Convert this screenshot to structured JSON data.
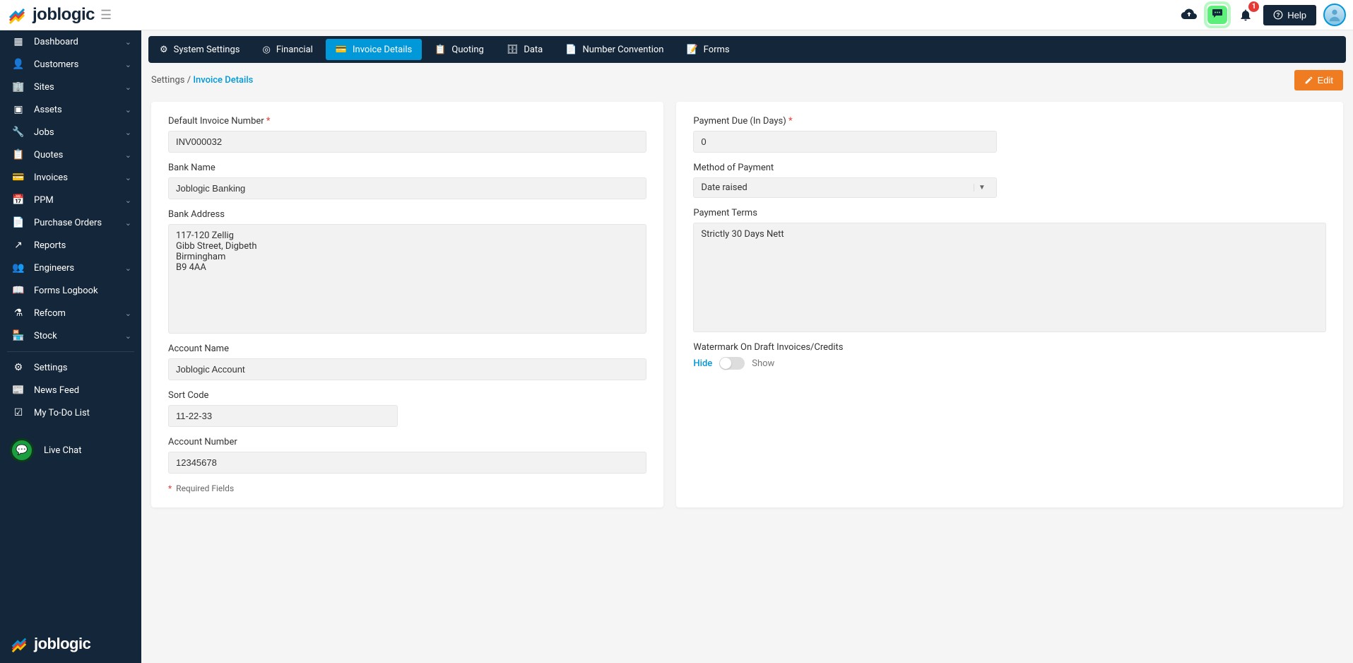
{
  "header": {
    "brand": "joblogic",
    "help_label": "Help",
    "notif_count": "1"
  },
  "sidebar": {
    "items": [
      {
        "label": "Dashboard"
      },
      {
        "label": "Customers"
      },
      {
        "label": "Sites"
      },
      {
        "label": "Assets"
      },
      {
        "label": "Jobs"
      },
      {
        "label": "Quotes"
      },
      {
        "label": "Invoices"
      },
      {
        "label": "PPM"
      },
      {
        "label": "Purchase Orders"
      },
      {
        "label": "Reports"
      },
      {
        "label": "Engineers"
      },
      {
        "label": "Forms Logbook"
      },
      {
        "label": "Refcom"
      },
      {
        "label": "Stock"
      }
    ],
    "secondary": [
      {
        "label": "Settings"
      },
      {
        "label": "News Feed"
      },
      {
        "label": "My To-Do List"
      }
    ],
    "live_chat_label": "Live Chat",
    "footer_brand": "joblogic"
  },
  "tabs": [
    {
      "label": "System Settings"
    },
    {
      "label": "Financial"
    },
    {
      "label": "Invoice Details"
    },
    {
      "label": "Quoting"
    },
    {
      "label": "Data"
    },
    {
      "label": "Number Convention"
    },
    {
      "label": "Forms"
    }
  ],
  "breadcrumb": {
    "root": "Settings",
    "sep": "/",
    "current": "Invoice Details"
  },
  "actions": {
    "edit_label": "Edit"
  },
  "left": {
    "default_invoice_number_label": "Default Invoice Number",
    "default_invoice_number_value": "INV000032",
    "bank_name_label": "Bank Name",
    "bank_name_value": "Joblogic Banking",
    "bank_address_label": "Bank Address",
    "bank_address_value": "117-120 Zellig\nGibb Street, Digbeth\nBirmingham\nB9 4AA",
    "account_name_label": "Account Name",
    "account_name_value": "Joblogic Account",
    "sort_code_label": "Sort Code",
    "sort_code_value": "11-22-33",
    "account_number_label": "Account Number",
    "account_number_value": "12345678",
    "required_note": "Required Fields"
  },
  "right": {
    "payment_due_label": "Payment Due (In Days)",
    "payment_due_value": "0",
    "method_label": "Method of Payment",
    "method_value": "Date raised",
    "terms_label": "Payment Terms",
    "terms_value": "Strictly 30 Days Nett",
    "watermark_label": "Watermark On Draft Invoices/Credits",
    "toggle_hide": "Hide",
    "toggle_show": "Show"
  }
}
